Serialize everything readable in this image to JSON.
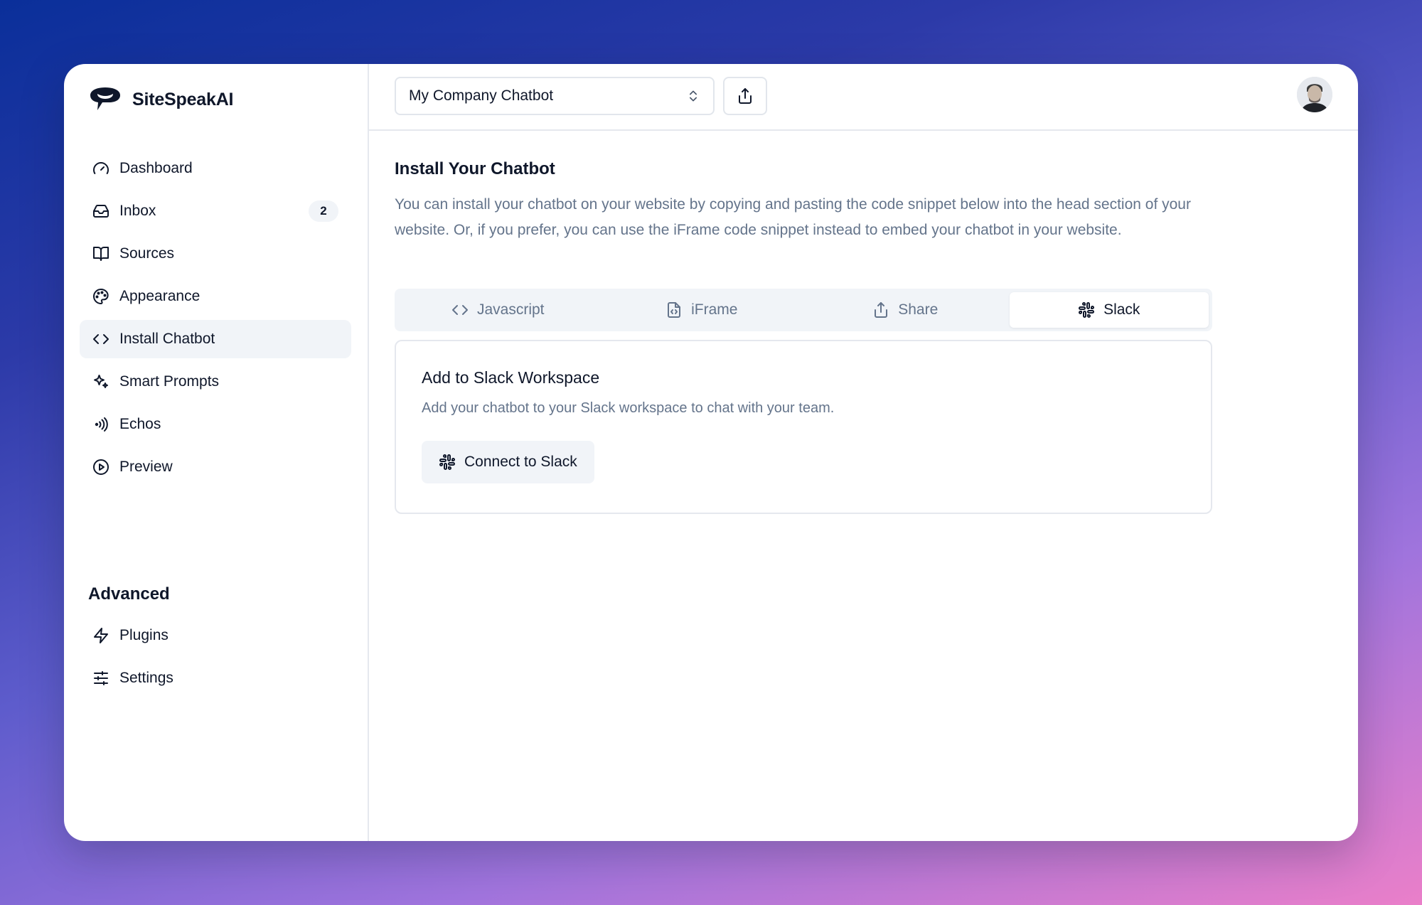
{
  "brand": {
    "name": "SiteSpeakAI"
  },
  "sidebar": {
    "items": [
      {
        "label": "Dashboard",
        "icon": "gauge-icon"
      },
      {
        "label": "Inbox",
        "icon": "inbox-icon",
        "badge": "2"
      },
      {
        "label": "Sources",
        "icon": "book-icon"
      },
      {
        "label": "Appearance",
        "icon": "palette-icon"
      },
      {
        "label": "Install Chatbot",
        "icon": "code-icon",
        "active": true
      },
      {
        "label": "Smart Prompts",
        "icon": "sparkles-icon"
      },
      {
        "label": "Echos",
        "icon": "broadcast-icon"
      },
      {
        "label": "Preview",
        "icon": "play-circle-icon"
      }
    ],
    "advanced_title": "Advanced",
    "advanced_items": [
      {
        "label": "Plugins",
        "icon": "zap-icon"
      },
      {
        "label": "Settings",
        "icon": "sliders-icon"
      }
    ]
  },
  "topbar": {
    "chatbot_name": "My Company Chatbot"
  },
  "main": {
    "title": "Install Your Chatbot",
    "description": "You can install your chatbot on your website by copying and pasting the code snippet below into the head section of your website. Or, if you prefer, you can use the iFrame code snippet instead to embed your chatbot in your website.",
    "tabs": [
      {
        "label": "Javascript",
        "icon": "code-icon"
      },
      {
        "label": "iFrame",
        "icon": "file-code-icon"
      },
      {
        "label": "Share",
        "icon": "share-icon"
      },
      {
        "label": "Slack",
        "icon": "slack-icon",
        "active": true
      }
    ],
    "card": {
      "title": "Add to Slack Workspace",
      "description": "Add your chatbot to your Slack workspace to chat with your team.",
      "button_label": "Connect to Slack"
    }
  },
  "colors": {
    "text": "#0f172a",
    "muted": "#64748b",
    "surface": "#f1f4f8",
    "border": "#e5e8ee"
  }
}
